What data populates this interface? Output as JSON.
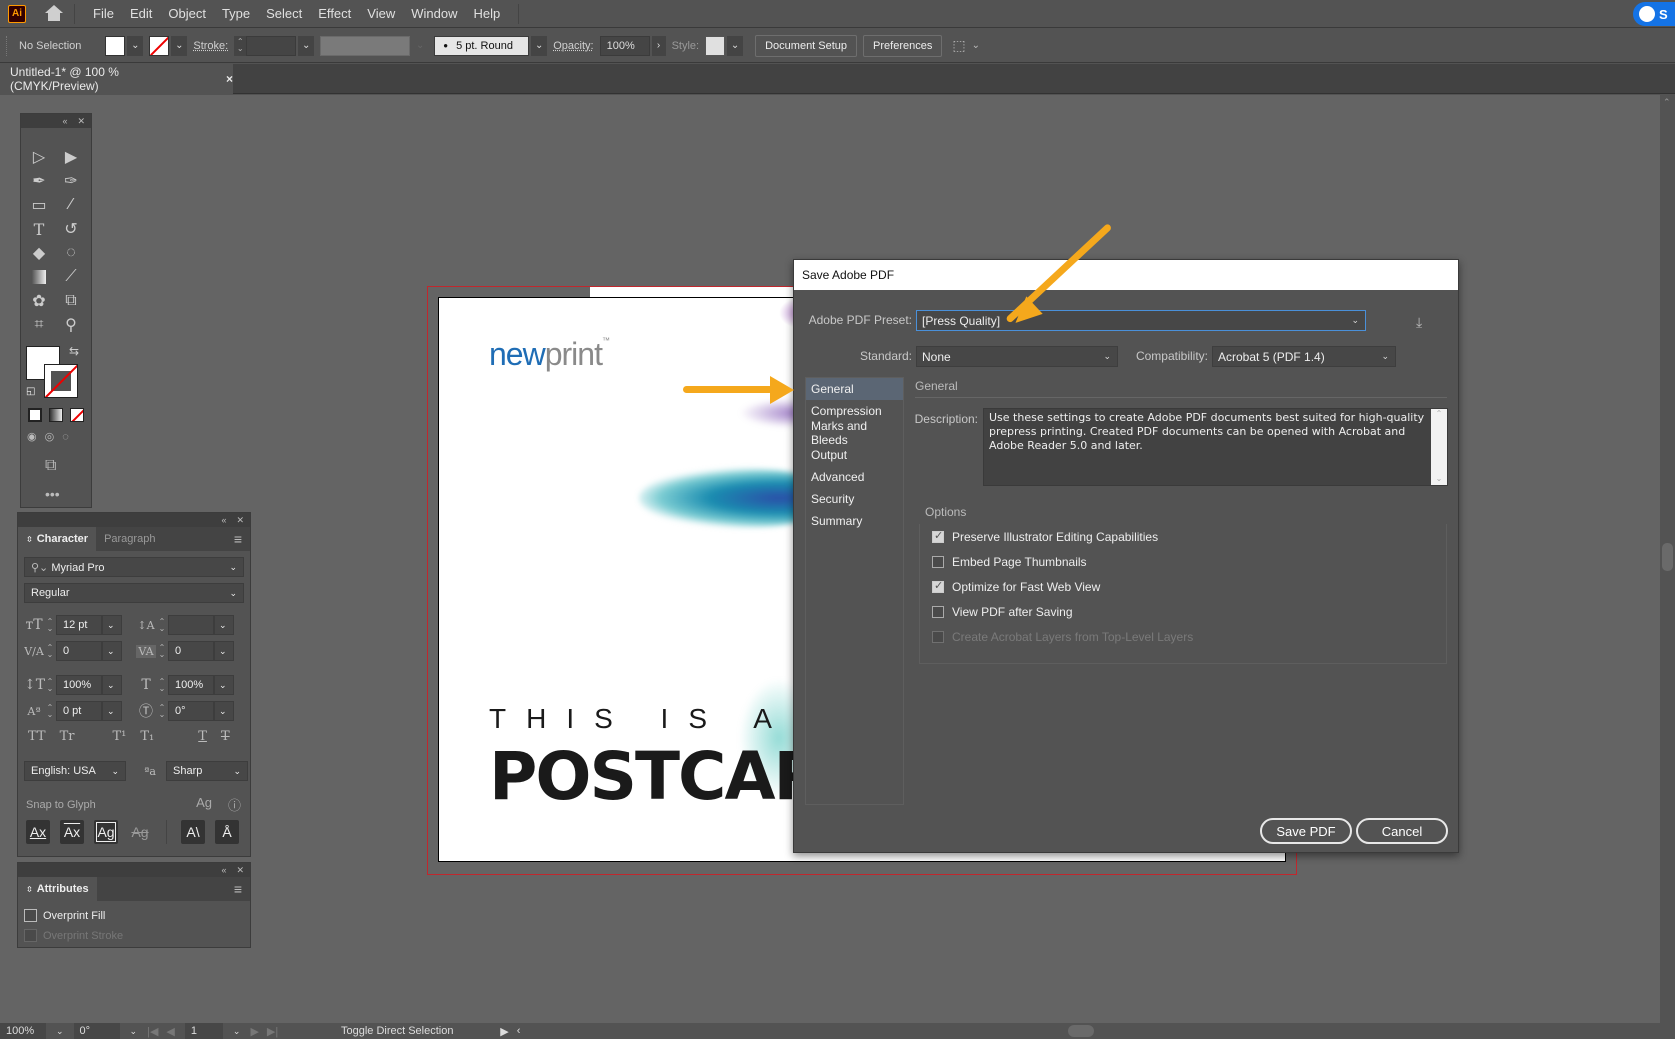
{
  "app": {
    "logo": "Ai",
    "home_icon": "home-icon"
  },
  "menu": [
    "File",
    "Edit",
    "Object",
    "Type",
    "Select",
    "Effect",
    "View",
    "Window",
    "Help"
  ],
  "share_label": "S",
  "control_bar": {
    "selection": "No Selection",
    "stroke_label": "Stroke:",
    "brush": "5 pt. Round",
    "opacity_label": "Opacity:",
    "opacity_value": "100%",
    "style_label": "Style:",
    "document_setup": "Document Setup",
    "preferences": "Preferences"
  },
  "document_tab": {
    "title": "Untitled-1* @ 100 % (CMYK/Preview)",
    "close": "×"
  },
  "character_panel": {
    "tabs": [
      "Character",
      "Paragraph"
    ],
    "font_family": "Myriad Pro",
    "font_style": "Regular",
    "font_size": "12 pt",
    "leading": "",
    "kerning": "0",
    "tracking": "0",
    "vertical_scale": "100%",
    "horizontal_scale": "100%",
    "baseline_shift": "0 pt",
    "rotation": "0°",
    "language": "English: USA",
    "anti_alias": "Sharp",
    "snap_to_glyph": "Snap to Glyph"
  },
  "attributes_panel": {
    "title": "Attributes",
    "overprint_fill": "Overprint Fill",
    "overprint_stroke": "Overprint Stroke"
  },
  "artboard": {
    "logo_new": "new",
    "logo_print": "print",
    "logo_tm": "™",
    "headline_small": "THIS IS A",
    "headline_big": "POSTCARD"
  },
  "dialog": {
    "title": "Save Adobe PDF",
    "preset_label": "Adobe PDF Preset:",
    "preset_value": "[Press Quality]",
    "standard_label": "Standard:",
    "standard_value": "None",
    "compat_label": "Compatibility:",
    "compat_value": "Acrobat 5 (PDF 1.4)",
    "nav": [
      "General",
      "Compression",
      "Marks and Bleeds",
      "Output",
      "Advanced",
      "Security",
      "Summary"
    ],
    "selected_nav": "General",
    "section_title": "General",
    "description_label": "Description:",
    "description": "Use these settings to create Adobe PDF documents best suited for high-quality prepress printing.  Created PDF documents can be opened with Acrobat and Adobe Reader 5.0 and later.",
    "options_title": "Options",
    "options": [
      {
        "label": "Preserve Illustrator Editing Capabilities",
        "checked": true,
        "enabled": true
      },
      {
        "label": "Embed Page Thumbnails",
        "checked": false,
        "enabled": true
      },
      {
        "label": "Optimize for Fast Web View",
        "checked": true,
        "enabled": true
      },
      {
        "label": "View PDF after Saving",
        "checked": false,
        "enabled": true
      },
      {
        "label": "Create Acrobat Layers from Top-Level Layers",
        "checked": false,
        "enabled": false
      }
    ],
    "save_button": "Save PDF",
    "cancel_button": "Cancel"
  },
  "status_bar": {
    "zoom": "100%",
    "rotation": "0°",
    "artboard_number": "1",
    "status_text": "Toggle Direct Selection"
  },
  "annotation_color": "#f5a81c"
}
